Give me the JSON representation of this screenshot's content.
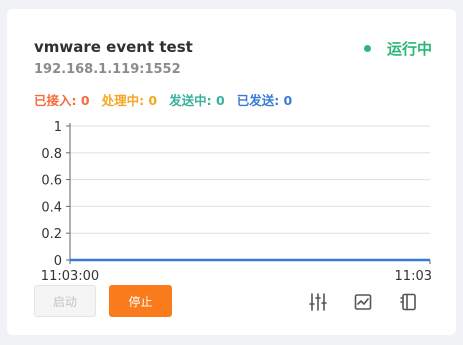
{
  "card": {
    "title": "vmware event test",
    "address": "192.168.1.119:1552",
    "status": {
      "label": "运行中",
      "color": "#2db67c"
    }
  },
  "counters": [
    {
      "label": "已接入:",
      "value": "0",
      "color": "#f56c3a"
    },
    {
      "label": "处理中:",
      "value": "0",
      "color": "#f5a623"
    },
    {
      "label": "发送中:",
      "value": "0",
      "color": "#3ab09e"
    },
    {
      "label": "已发送:",
      "value": "0",
      "color": "#3a7bd5"
    }
  ],
  "chart_data": {
    "type": "line",
    "x": [
      "11:03:00",
      "11:03"
    ],
    "series": [
      {
        "values": [
          0,
          0
        ],
        "color": "#3a7bd5"
      }
    ],
    "yticks": [
      "1",
      "0.8",
      "0.6",
      "0.4",
      "0.2",
      "0"
    ],
    "xticks": [
      "11:03:00",
      "11:03"
    ],
    "ylim": [
      0,
      1
    ],
    "grid": true
  },
  "buttons": {
    "start_label": "启动",
    "stop_label": "停止"
  },
  "toolbar": {
    "icons": [
      "settings-sliders-icon",
      "chart-monitor-icon",
      "panel-icon"
    ]
  }
}
